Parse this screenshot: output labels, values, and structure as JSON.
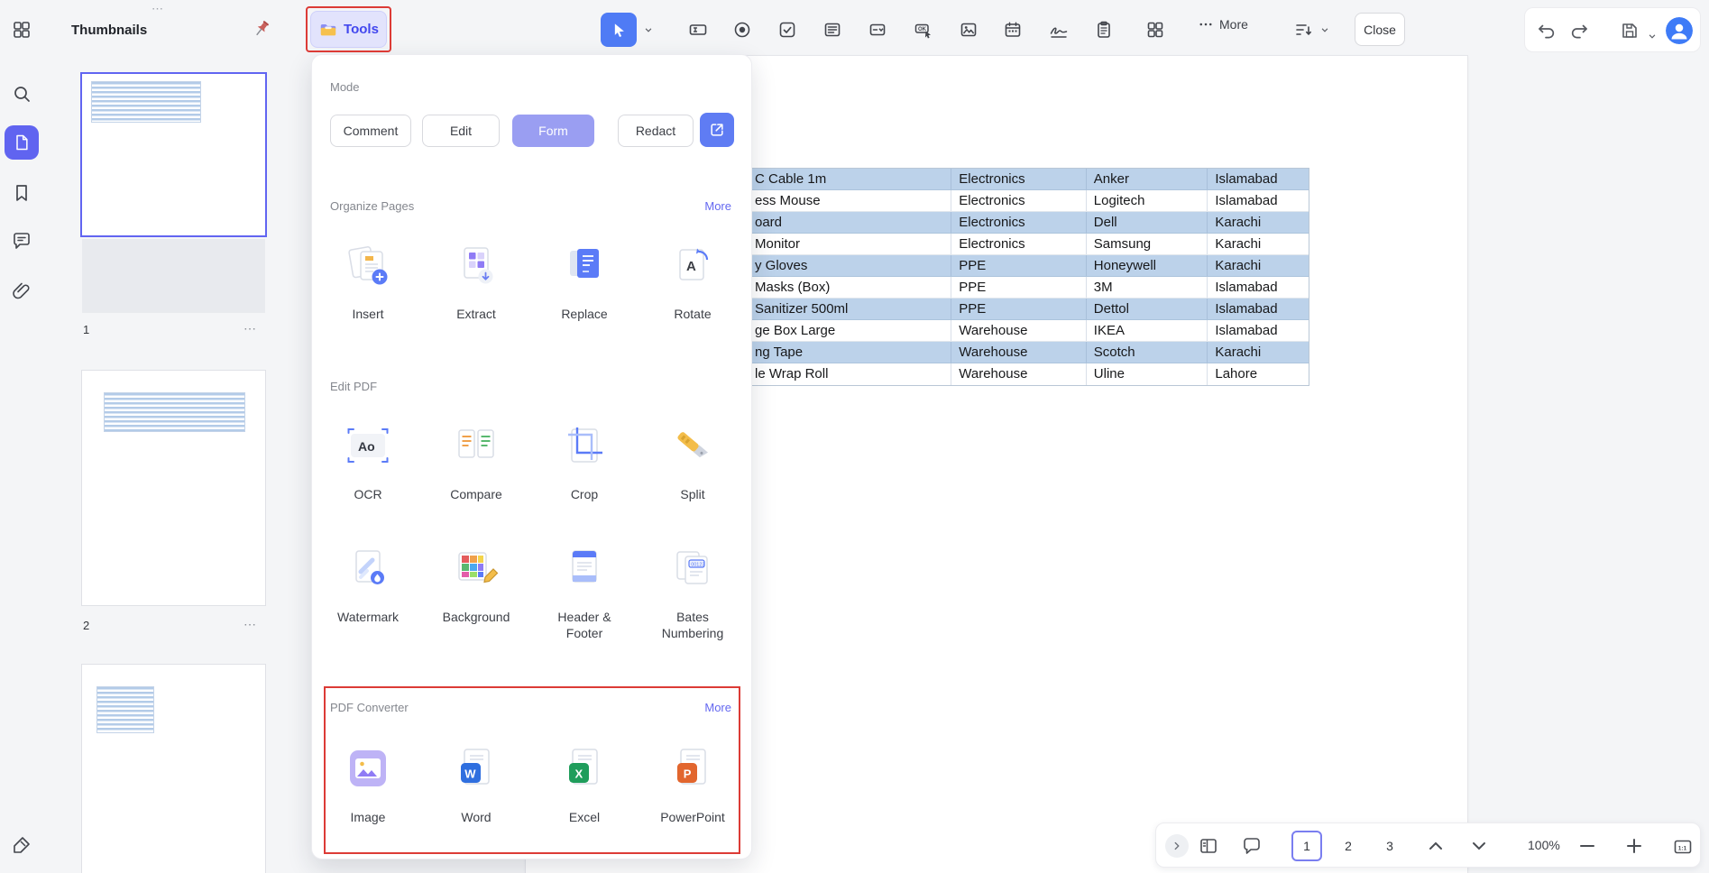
{
  "icons": {
    "ellipsis": "⋯",
    "ok_stamp": "OK",
    "ocr_sample": "Ao",
    "rotate_letter": "A",
    "bates_sample": "00123",
    "word_letter": "W",
    "excel_letter": "X",
    "powerpoint_letter": "P",
    "one_to_one": "1:1"
  },
  "top_bar": {
    "thumbnails_label": "Thumbnails",
    "tools_button_label": "Tools",
    "more_label": "More",
    "close_button_label": "Close"
  },
  "tools_panel": {
    "mode_label": "Mode",
    "mode_comment": "Comment",
    "mode_edit": "Edit",
    "mode_form": "Form",
    "mode_redact": "Redact",
    "organize_title": "Organize Pages",
    "organize_more": "More",
    "organize_items": [
      "Insert",
      "Extract",
      "Replace",
      "Rotate"
    ],
    "edit_title": "Edit PDF",
    "edit_items": [
      "OCR",
      "Compare",
      "Crop",
      "Split",
      "Watermark",
      "Background",
      "Header & Footer",
      "Bates Numbering"
    ],
    "converter_title": "PDF Converter",
    "converter_more": "More",
    "converter_items": [
      "Image",
      "Word",
      "Excel",
      "PowerPoint"
    ]
  },
  "thumbnails": {
    "page1_label": "1",
    "page2_label": "2"
  },
  "document": {
    "table": {
      "rows": [
        {
          "item": "C Cable 1m",
          "category": "Electronics",
          "brand": "Anker",
          "city": "Islamabad"
        },
        {
          "item": "ess Mouse",
          "category": "Electronics",
          "brand": "Logitech",
          "city": "Islamabad"
        },
        {
          "item": "oard",
          "category": "Electronics",
          "brand": "Dell",
          "city": "Karachi"
        },
        {
          "item": "Monitor",
          "category": "Electronics",
          "brand": "Samsung",
          "city": "Karachi"
        },
        {
          "item": "y Gloves",
          "category": "PPE",
          "brand": "Honeywell",
          "city": "Karachi"
        },
        {
          "item": "Masks (Box)",
          "category": "PPE",
          "brand": "3M",
          "city": "Islamabad"
        },
        {
          "item": "Sanitizer 500ml",
          "category": "PPE",
          "brand": "Dettol",
          "city": "Islamabad"
        },
        {
          "item": "ge Box Large",
          "category": "Warehouse",
          "brand": "IKEA",
          "city": "Islamabad"
        },
        {
          "item": "ng Tape",
          "category": "Warehouse",
          "brand": "Scotch",
          "city": "Karachi"
        },
        {
          "item": "le Wrap Roll",
          "category": "Warehouse",
          "brand": "Uline",
          "city": "Lahore"
        }
      ]
    }
  },
  "bottom_bar": {
    "page_1": "1",
    "page_2": "2",
    "page_3": "3",
    "zoom_level": "100%"
  },
  "colors": {
    "accent": "#5f63f2",
    "annotation_red": "#dc3b36",
    "row_highlight": "#bcd2ea"
  }
}
